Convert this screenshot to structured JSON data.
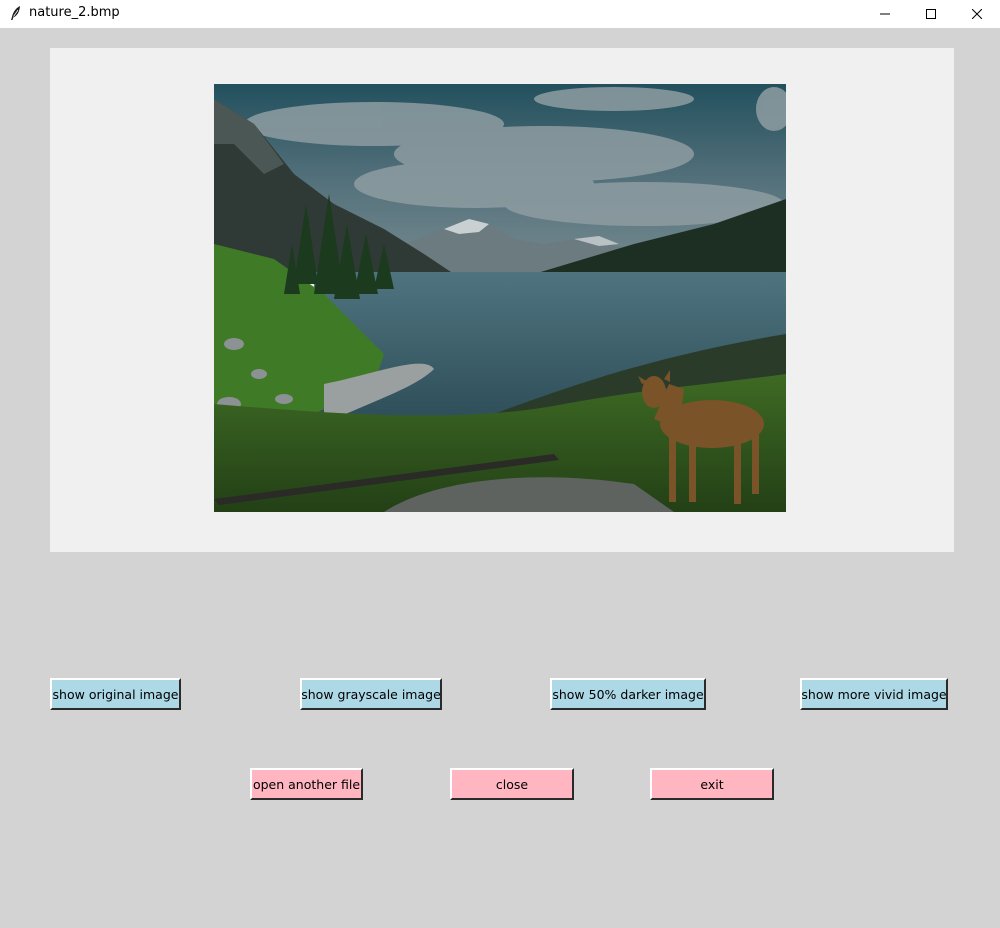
{
  "window": {
    "title": "nature_2.bmp",
    "icon": "feather-icon",
    "controls": {
      "minimize_icon": "minimize-icon",
      "maximize_icon": "maximize-icon",
      "close_icon": "close-icon"
    }
  },
  "image": {
    "name": "nature_2.bmp",
    "description_icon": "landscape-photo"
  },
  "filter_buttons": {
    "original": "show original image",
    "grayscale": "show grayscale image",
    "darker": "show 50% darker image",
    "vivid": "show more vivid image",
    "color": "#add8e6"
  },
  "file_buttons": {
    "open": "open another file",
    "close": "close",
    "exit": "exit",
    "color": "#ffb6c1"
  }
}
